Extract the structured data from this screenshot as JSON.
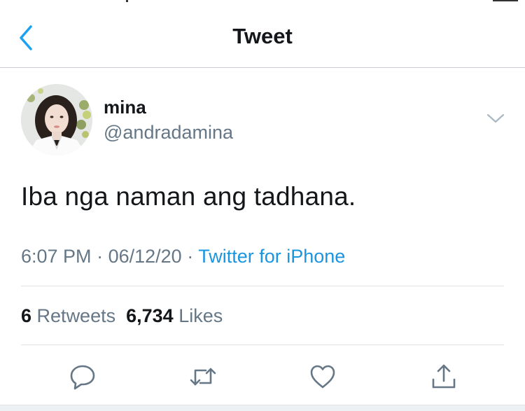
{
  "navbar": {
    "title": "Tweet",
    "back_icon": "chevron-left-icon"
  },
  "tweet": {
    "display_name": "mina",
    "handle": "@andradamina",
    "text": "Iba nga naman ang tadhana.",
    "time": "6:07 PM",
    "separator": "·",
    "date": "06/12/20",
    "source": "Twitter for iPhone",
    "retweets_count": "6",
    "retweets_label": "Retweets",
    "likes_count": "6,734",
    "likes_label": "Likes"
  },
  "actions": [
    {
      "icon": "reply-icon"
    },
    {
      "icon": "retweet-icon"
    },
    {
      "icon": "like-icon"
    },
    {
      "icon": "share-icon"
    }
  ],
  "colors": {
    "accent": "#1da1f2",
    "link": "#1b95e0",
    "secondary_text": "#657786",
    "primary_text": "#14171a"
  }
}
